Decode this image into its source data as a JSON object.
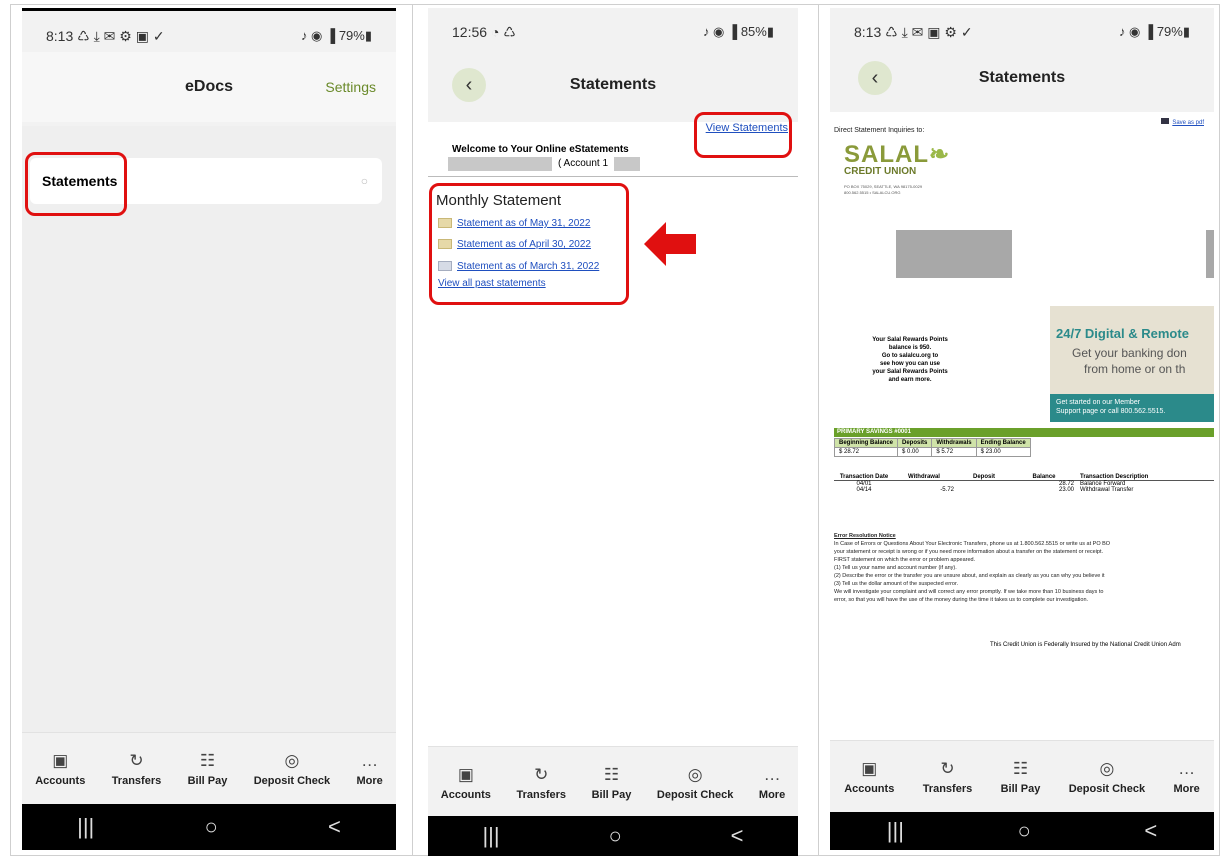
{
  "status": {
    "p1": {
      "time": "8:13",
      "icons_left": "♺ ⤓ ✉ ⚙ ▣ ✓",
      "icons_right": "♪ ◉ ▐ 79%▮"
    },
    "p2": {
      "time": "12:56",
      "icons_left": "◔ ♺",
      "icons_right": "♪ ◉ ▐ 85%▮"
    },
    "p3": {
      "time": "8:13",
      "icons_left": "♺ ⤓ ✉ ▣ ⚙ ✓",
      "icons_right": "♪ ◉ ▐ 79%▮"
    }
  },
  "p1": {
    "title": "eDocs",
    "settings": "Settings",
    "statements_item": "Statements"
  },
  "p2": {
    "title": "Statements",
    "view_statements": "View Statements",
    "welcome": "Welcome to Your Online eStatements",
    "account": "( Account 1",
    "section_title": "Monthly Statement",
    "links": [
      "Statement as of May 31, 2022",
      "Statement as of April 30, 2022",
      "Statement as of March 31, 2022"
    ],
    "view_all": "View all past statements"
  },
  "p3": {
    "title": "Statements",
    "save_pdf": "Save as pdf",
    "inquiries": "Direct Statement Inquiries to:",
    "brand": "SALAL",
    "brand_sub": "CREDIT UNION",
    "address1": "PO BOX 75029, SEATTLE, WA 98175-0029",
    "address2": "800.562.5515  •  SALALCU.ORG",
    "rewards": [
      "Your Salal Rewards Points",
      "balance is 950.",
      "Go to salalcu.org to",
      "see how you can use",
      "your Salal Rewards Points",
      "and earn more."
    ],
    "promo_title": "24/7 Digital & Remote",
    "promo_line1": "Get your banking don",
    "promo_line2": "from home or on th",
    "promo_foot1": "Get started on our Member",
    "promo_foot2": "Support page or call 800.562.5515.",
    "savings_header": "PRIMARY SAVINGS  #0001",
    "summary_headers": [
      "Beginning Balance",
      "Deposits",
      "Withdrawals",
      "Ending Balance"
    ],
    "summary_values": [
      "$ 28.72",
      "$ 0.00",
      "$ 5.72",
      "$ 23.00"
    ],
    "txn_headers": [
      "Transaction Date",
      "Withdrawal",
      "Deposit",
      "Balance",
      "Transaction Description"
    ],
    "txn_rows": [
      [
        "04/01",
        "",
        "",
        "28.72",
        "Balance Forward"
      ],
      [
        "04/14",
        "-5.72",
        "",
        "23.00",
        "Withdrawal Transfer"
      ]
    ],
    "error_title": "Error Resolution Notice",
    "error_lines": [
      "In Case of Errors or Questions About Your Electronic Transfers, phone us at 1.800.562.5515 or write us at PO BO",
      "your statement or receipt is wrong or if you need more information about a transfer on the statement or receipt.",
      "FIRST statement on which the error or problem appeared.",
      "   (1) Tell us your name and account number (if any).",
      "   (2) Describe the error or the transfer you are unsure about, and explain as clearly as you can why you believe it",
      "   (3) Tell us the dollar amount of the suspected error.",
      "We will investigate your complaint and will correct any error promptly. If we take more than 10 business days to",
      "error, so that you will have the use of the money during the time it takes us to complete our investigation."
    ],
    "insured": "This Credit Union is Federally Insured by the National Credit Union Adm"
  },
  "tabs": [
    {
      "label": "Accounts",
      "icon": "▣"
    },
    {
      "label": "Transfers",
      "icon": "↻"
    },
    {
      "label": "Bill Pay",
      "icon": "☷"
    },
    {
      "label": "Deposit Check",
      "icon": "◎"
    },
    {
      "label": "More",
      "icon": "…"
    }
  ],
  "nav": {
    "recent": "|||",
    "home": "○",
    "back": "<"
  }
}
